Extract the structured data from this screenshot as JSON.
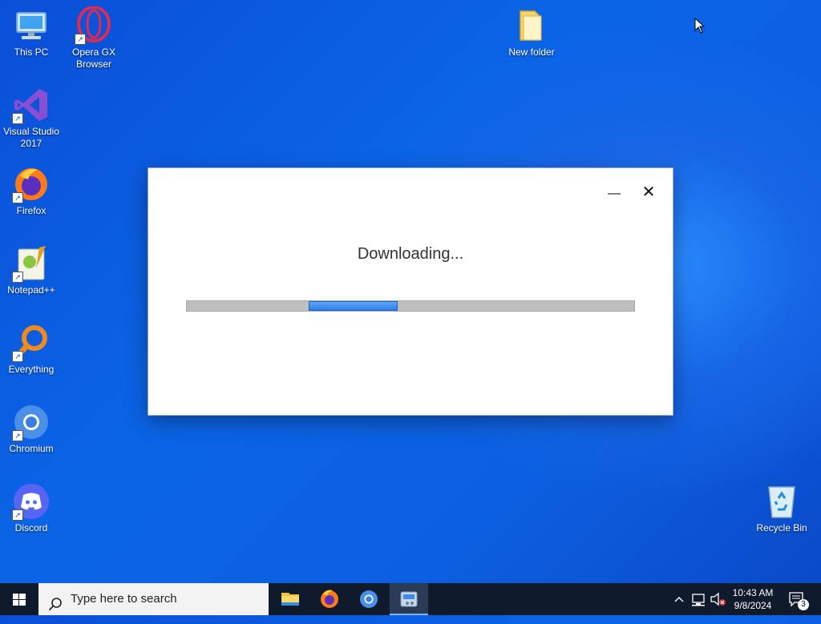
{
  "desktop": {
    "icons": [
      {
        "label": "This PC",
        "icon": "monitor-icon"
      },
      {
        "label": "Opera GX Browser",
        "icon": "opera-gx-icon"
      },
      {
        "label": "New folder",
        "icon": "folder-icon"
      },
      {
        "label": "Visual Studio 2017",
        "icon": "visual-studio-icon"
      },
      {
        "label": "Firefox",
        "icon": "firefox-icon"
      },
      {
        "label": "Notepad++",
        "icon": "notepadpp-icon"
      },
      {
        "label": "Everything",
        "icon": "everything-icon"
      },
      {
        "label": "Chromium",
        "icon": "chromium-icon"
      },
      {
        "label": "Discord",
        "icon": "discord-icon"
      },
      {
        "label": "Recycle Bin",
        "icon": "recycle-bin-icon"
      }
    ]
  },
  "dialog": {
    "title": "Downloading...",
    "minimize_glyph": "—",
    "close_glyph": "✕"
  },
  "taskbar": {
    "search_placeholder": "Type here to search",
    "apps": [
      "file-explorer-icon",
      "firefox-icon",
      "chromium-icon",
      "installer-icon"
    ],
    "clock_time": "10:43 AM",
    "clock_date": "9/8/2024",
    "notification_count": "3"
  },
  "colors": {
    "desktop_blue": "#0b5fe0",
    "taskbar": "#0f1a2d",
    "progress_fill": "#2f7ee9",
    "progress_track": "#bfbfbf"
  }
}
